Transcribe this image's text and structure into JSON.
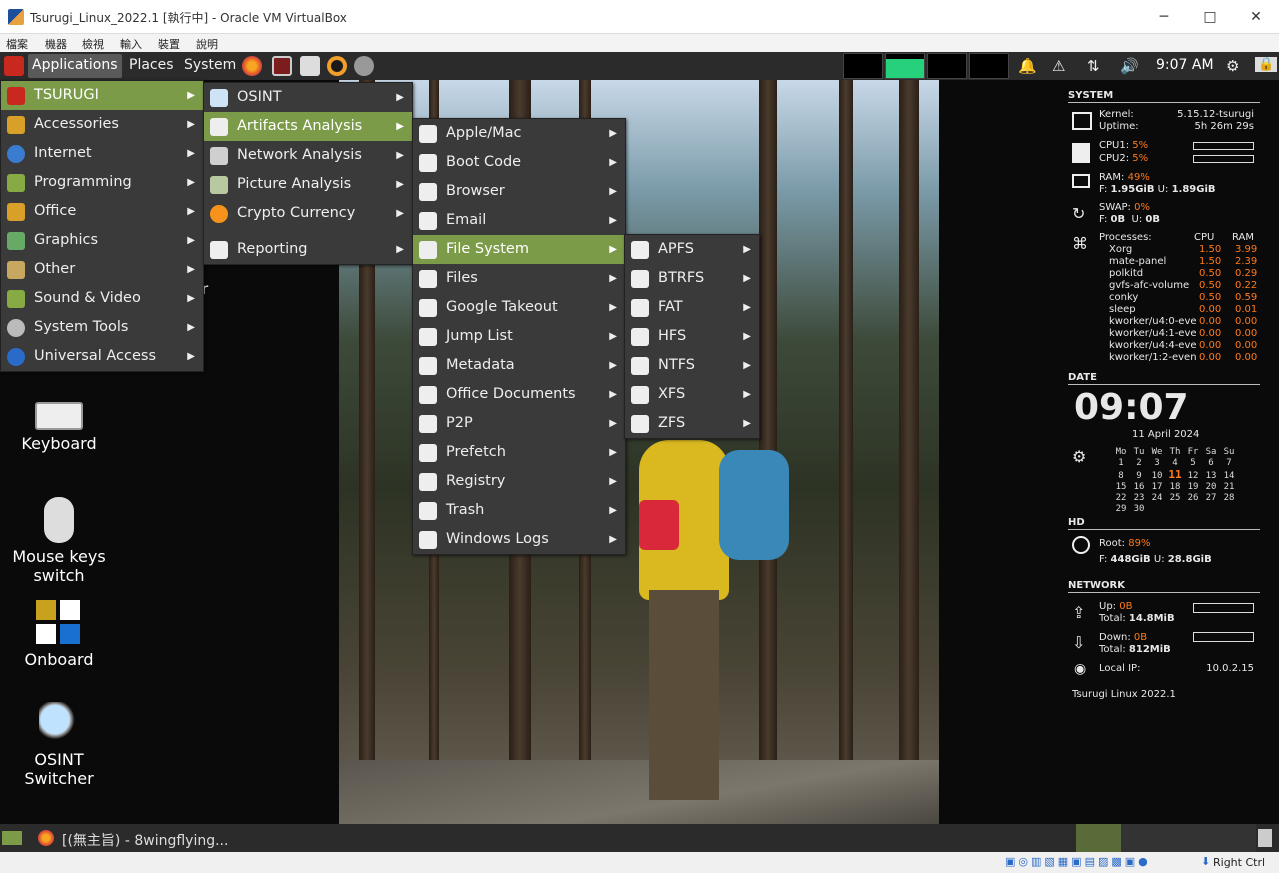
{
  "host": {
    "title": "Tsurugi_Linux_2022.1 [執行中] - Oracle VM VirtualBox",
    "menu": [
      "檔案",
      "機器",
      "檢視",
      "輸入",
      "裝置",
      "說明"
    ],
    "status_right": "Right Ctrl"
  },
  "top_panel": {
    "applications": "Applications",
    "places": "Places",
    "system": "System",
    "clock": "9:07 AM"
  },
  "menu_root": [
    {
      "label": "TSURUGI",
      "icon": "tsurugi-icon"
    },
    {
      "label": "Accessories",
      "icon": "accessories-icon"
    },
    {
      "label": "Internet",
      "icon": "globe-icon"
    },
    {
      "label": "Programming",
      "icon": "programming-icon"
    },
    {
      "label": "Office",
      "icon": "office-icon"
    },
    {
      "label": "Graphics",
      "icon": "graphics-icon"
    },
    {
      "label": "Other",
      "icon": "other-icon"
    },
    {
      "label": "Sound & Video",
      "icon": "sound-video-icon"
    },
    {
      "label": "System Tools",
      "icon": "gear-icon"
    },
    {
      "label": "Universal Access",
      "icon": "accessibility-icon"
    }
  ],
  "menu_tsurugi": [
    {
      "label": "OSINT",
      "icon": "magnifier-icon"
    },
    {
      "label": "Artifacts Analysis",
      "icon": "footprints-icon"
    },
    {
      "label": "Network Analysis",
      "icon": "network-icon"
    },
    {
      "label": "Picture Analysis",
      "icon": "picture-icon"
    },
    {
      "label": "Crypto Currency",
      "icon": "bitcoin-icon"
    },
    {
      "label": "Reporting",
      "icon": "report-icon"
    }
  ],
  "menu_artifacts": [
    "Apple/Mac",
    "Boot Code",
    "Browser",
    "Email",
    "File System",
    "Files",
    "Google Takeout",
    "Jump List",
    "Metadata",
    "Office Documents",
    "P2P",
    "Prefetch",
    "Registry",
    "Trash",
    "Windows Logs"
  ],
  "menu_filesystem": [
    "APFS",
    "BTRFS",
    "FAT",
    "HFS",
    "NTFS",
    "XFS",
    "ZFS"
  ],
  "desktop_icons": [
    {
      "label": "Keyboard"
    },
    {
      "label": "Mouse keys\nswitch"
    },
    {
      "label": "Onboard"
    },
    {
      "label": "OSINT\nSwitcher"
    }
  ],
  "desktop_fragment": "r",
  "conky": {
    "system_h": "SYSTEM",
    "kernel_l": "Kernel:",
    "kernel_v": "5.15.12-tsurugi",
    "uptime_l": "Uptime:",
    "uptime_v": "5h 26m 29s",
    "cpu1_l": "CPU1:",
    "cpu1_v": "5%",
    "cpu2_l": "CPU2:",
    "cpu2_v": "5%",
    "ram_l": "RAM:",
    "ram_v": "49%",
    "ram_f_l": "F:",
    "ram_f": "1.95GiB",
    "ram_u_l": "U:",
    "ram_u": "1.89GiB",
    "swap_l": "SWAP:",
    "swap_v": "0%",
    "swap_f_l": "F:",
    "swap_f": "0B",
    "swap_u_l": "U:",
    "swap_u": "0B",
    "proc_h": "Processes:",
    "cpu_h": "CPU",
    "ram_h": "RAM",
    "processes": [
      {
        "name": "Xorg",
        "cpu": "1.50",
        "ram": "3.99"
      },
      {
        "name": "mate-panel",
        "cpu": "1.50",
        "ram": "2.39"
      },
      {
        "name": "polkitd",
        "cpu": "0.50",
        "ram": "0.29"
      },
      {
        "name": "gvfs-afc-volume",
        "cpu": "0.50",
        "ram": "0.22"
      },
      {
        "name": "conky",
        "cpu": "0.50",
        "ram": "0.59"
      },
      {
        "name": "sleep",
        "cpu": "0.00",
        "ram": "0.01"
      },
      {
        "name": "kworker/u4:0-eve",
        "cpu": "0.00",
        "ram": "0.00"
      },
      {
        "name": "kworker/u4:1-eve",
        "cpu": "0.00",
        "ram": "0.00"
      },
      {
        "name": "kworker/u4:4-eve",
        "cpu": "0.00",
        "ram": "0.00"
      },
      {
        "name": "kworker/1:2-even",
        "cpu": "0.00",
        "ram": "0.00"
      }
    ],
    "date_h": "DATE",
    "time": "09:07",
    "date": "11 April 2024",
    "cal_head": [
      "Mo",
      "Tu",
      "We",
      "Th",
      "Fr",
      "Sa",
      "Su"
    ],
    "cal_rows": [
      [
        "",
        "1",
        "2",
        "3",
        "4",
        "5",
        "6",
        "7"
      ],
      [
        "",
        "8",
        "9",
        "10",
        "11",
        "12",
        "13",
        "14"
      ],
      [
        "",
        "15",
        "16",
        "17",
        "18",
        "19",
        "20",
        "21"
      ],
      [
        "",
        "22",
        "23",
        "24",
        "25",
        "26",
        "27",
        "28"
      ],
      [
        "",
        "29",
        "30",
        "",
        "",
        "",
        "",
        ""
      ]
    ],
    "hd_h": "HD",
    "root_l": "Root:",
    "root_v": "89%",
    "hd_f_l": "F:",
    "hd_f": "448GiB",
    "hd_u_l": "U:",
    "hd_u": "28.8GiB",
    "net_h": "NETWORK",
    "up_l": "Up:",
    "up_v": "0B",
    "up_total_l": "Total:",
    "up_total": "14.8MiB",
    "down_l": "Down:",
    "down_v": "0B",
    "down_total_l": "Total:",
    "down_total": "812MiB",
    "localip_l": "Local IP:",
    "localip_v": "10.0.2.15",
    "footer": "Tsurugi Linux 2022.1"
  },
  "bottom_panel": {
    "task": "[(無主旨) - 8wingflying..."
  },
  "colors": {
    "menu_active": "#7c9b49",
    "conky_orange": "#ff7a1a",
    "panel_bg": "#2b2b2b"
  }
}
